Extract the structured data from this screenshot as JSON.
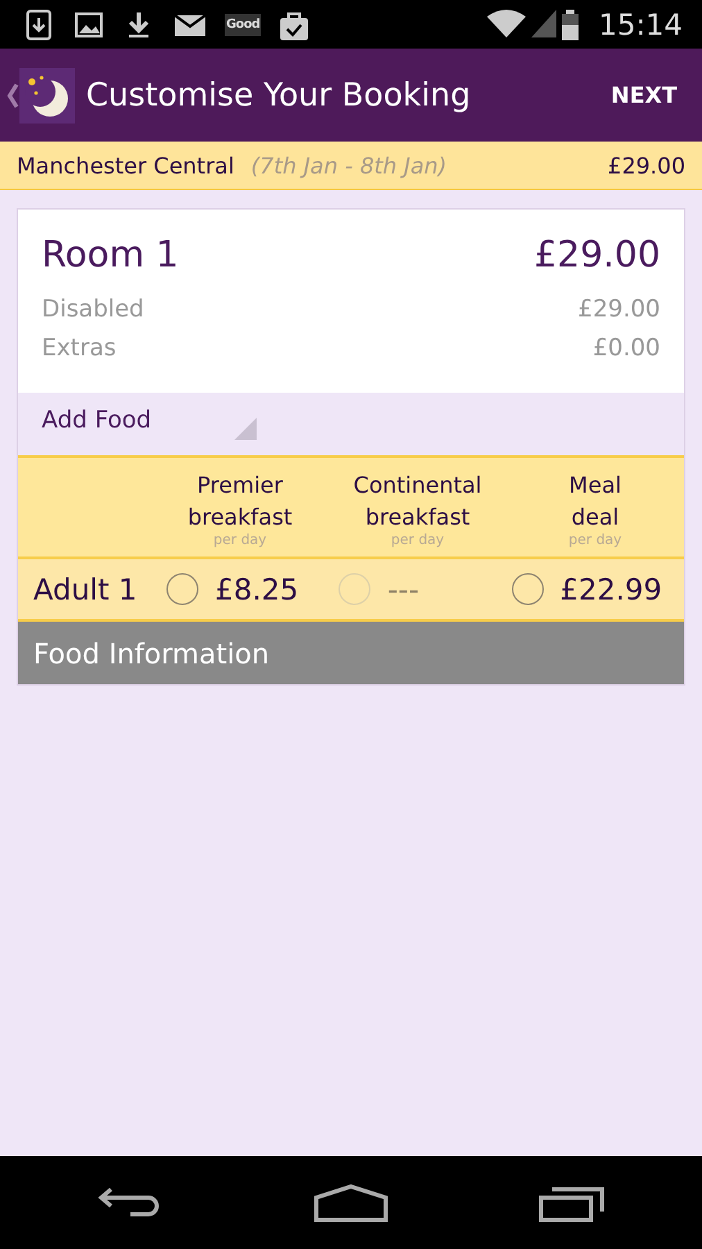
{
  "status_bar": {
    "notification_badge": "Good",
    "time": "15:14"
  },
  "app_bar": {
    "title": "Customise Your Booking",
    "action": "NEXT"
  },
  "summary": {
    "hotel": "Manchester Central",
    "dates": "(7th Jan - 8th Jan)",
    "total": "£29.00"
  },
  "room": {
    "title": "Room 1",
    "price": "£29.00",
    "lines": [
      {
        "label": "Disabled",
        "amount": "£29.00"
      },
      {
        "label": "Extras",
        "amount": "£0.00"
      }
    ]
  },
  "add_food": {
    "label": "Add Food"
  },
  "food_table": {
    "columns": [
      {
        "name": "Premier breakfast",
        "unit": "per day"
      },
      {
        "name": "Continental breakfast",
        "unit": "per day"
      },
      {
        "name": "Meal deal",
        "unit": "per day"
      }
    ],
    "rows": [
      {
        "guest": "Adult 1",
        "options": [
          {
            "price": "£8.25",
            "selected": false,
            "disabled": false
          },
          {
            "price": "---",
            "selected": false,
            "disabled": true
          },
          {
            "price": "£22.99",
            "selected": false,
            "disabled": false
          }
        ]
      }
    ]
  },
  "food_information": {
    "label": "Food Information"
  }
}
